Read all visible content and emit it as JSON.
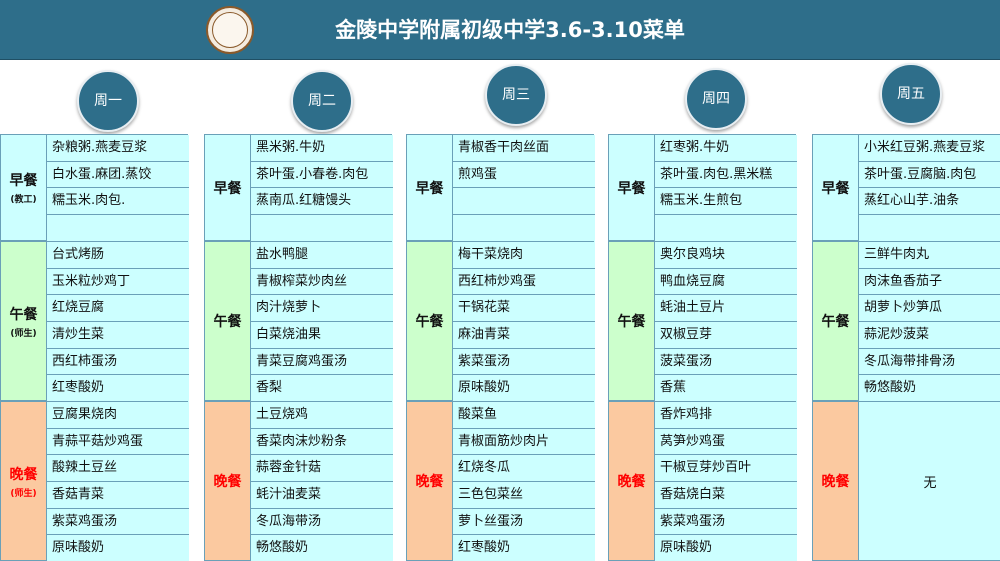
{
  "title": "金陵中学附属初级中学3.6-3.10菜单",
  "days": [
    {
      "name": "周一",
      "breakfast": {
        "label": "早餐",
        "sub": "(教工)",
        "items": [
          "杂粮粥.燕麦豆浆",
          "白水蛋.麻团.蒸饺",
          "糯玉米.肉包.",
          ""
        ]
      },
      "lunch": {
        "label": "午餐",
        "sub": "(师生)",
        "items": [
          "台式烤肠",
          "玉米粒炒鸡丁",
          "红烧豆腐",
          "清炒生菜",
          "西红柿蛋汤",
          "红枣酸奶"
        ]
      },
      "dinner": {
        "label": "晚餐",
        "sub": "(师生)",
        "items": [
          "豆腐果烧肉",
          "青蒜平菇炒鸡蛋",
          "酸辣土豆丝",
          "香菇青菜",
          "紫菜鸡蛋汤",
          "原味酸奶"
        ]
      }
    },
    {
      "name": "周二",
      "breakfast": {
        "label": "早餐",
        "sub": "",
        "items": [
          "黑米粥.牛奶",
          "茶叶蛋.小春卷.肉包",
          "蒸南瓜.红糖馒头",
          ""
        ]
      },
      "lunch": {
        "label": "午餐",
        "sub": "",
        "items": [
          "盐水鸭腿",
          "青椒榨菜炒肉丝",
          "肉汁烧萝卜",
          "白菜烧油果",
          "青菜豆腐鸡蛋汤",
          "香梨"
        ]
      },
      "dinner": {
        "label": "晚餐",
        "sub": "",
        "items": [
          "土豆烧鸡",
          "香菜肉沫炒粉条",
          "蒜蓉金针菇",
          "蚝汁油麦菜",
          "冬瓜海带汤",
          "畅悠酸奶"
        ]
      }
    },
    {
      "name": "周三",
      "breakfast": {
        "label": "早餐",
        "sub": "",
        "items": [
          "青椒香干肉丝面",
          "煎鸡蛋",
          "",
          ""
        ]
      },
      "lunch": {
        "label": "午餐",
        "sub": "",
        "items": [
          "梅干菜烧肉",
          "西红柿炒鸡蛋",
          "干锅花菜",
          "麻油青菜",
          "紫菜蛋汤",
          "原味酸奶"
        ]
      },
      "dinner": {
        "label": "晚餐",
        "sub": "",
        "items": [
          "酸菜鱼",
          "青椒面筋炒肉片",
          "红烧冬瓜",
          "三色包菜丝",
          "萝卜丝蛋汤",
          "红枣酸奶"
        ]
      }
    },
    {
      "name": "周四",
      "breakfast": {
        "label": "早餐",
        "sub": "",
        "items": [
          "红枣粥.牛奶",
          "茶叶蛋.肉包.黑米糕",
          "糯玉米.生煎包",
          ""
        ]
      },
      "lunch": {
        "label": "午餐",
        "sub": "",
        "items": [
          "奥尔良鸡块",
          "鸭血烧豆腐",
          "蚝油土豆片",
          "双椒豆芽",
          "菠菜蛋汤",
          "香蕉"
        ]
      },
      "dinner": {
        "label": "晚餐",
        "sub": "",
        "items": [
          "香炸鸡排",
          "莴笋炒鸡蛋",
          "干椒豆芽炒百叶",
          "香菇烧白菜",
          "紫菜鸡蛋汤",
          "原味酸奶"
        ]
      }
    },
    {
      "name": "周五",
      "breakfast": {
        "label": "早餐",
        "sub": "",
        "items": [
          "小米红豆粥.燕麦豆浆",
          "茶叶蛋.豆腐脑.肉包",
          "蒸红心山芋.油条",
          ""
        ]
      },
      "lunch": {
        "label": "午餐",
        "sub": "",
        "items": [
          "三鲜牛肉丸",
          "肉沫鱼香茄子",
          "胡萝卜炒笋瓜",
          "蒜泥炒菠菜",
          "冬瓜海带排骨汤",
          "畅悠酸奶"
        ]
      },
      "dinner": {
        "label": "晚餐",
        "sub": "",
        "items": [],
        "none": "无"
      }
    }
  ]
}
